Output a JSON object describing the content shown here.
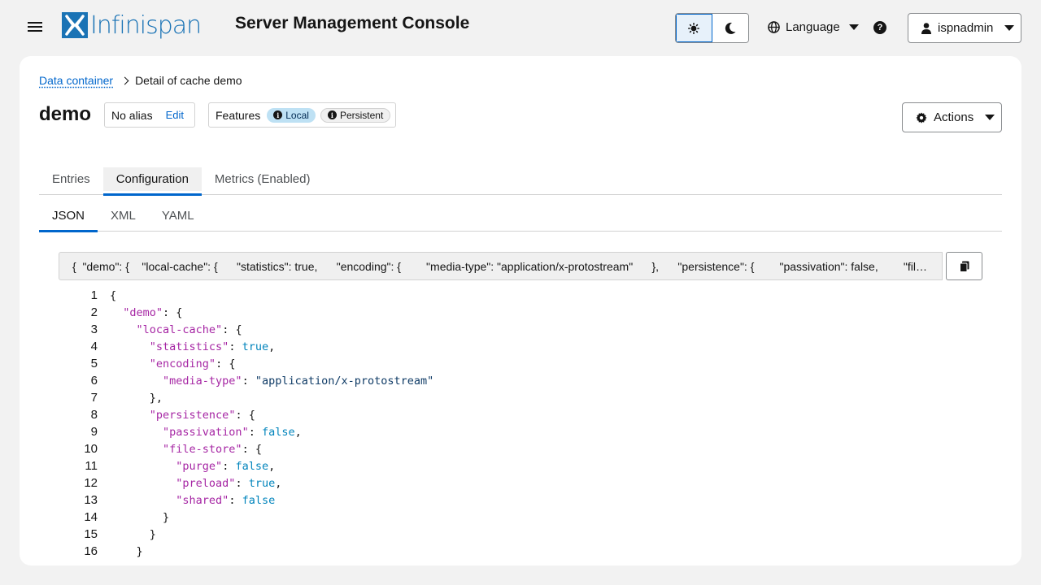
{
  "header": {
    "brand": "Infinispan",
    "title": "Server Management Console",
    "language_label": "Language",
    "help_glyph": "?",
    "user_label": "ispnadmin"
  },
  "breadcrumb": {
    "parent": "Data container",
    "current": "Detail of cache demo"
  },
  "cache": {
    "name": "demo",
    "alias": "No alias",
    "edit_label": "Edit",
    "features_label": "Features",
    "features": [
      "Local",
      "Persistent"
    ]
  },
  "actions_label": "Actions",
  "tabs": [
    {
      "label": "Entries"
    },
    {
      "label": "Configuration",
      "active": true
    },
    {
      "label": "Metrics (Enabled)"
    }
  ],
  "subtabs": [
    {
      "label": "JSON",
      "active": true
    },
    {
      "label": "XML"
    },
    {
      "label": "YAML"
    }
  ],
  "preview_text": "{  \"demo\": {    \"local-cache\": {      \"statistics\": true,      \"encoding\": {        \"media-type\": \"application/x-protostream\"      },      \"persistence\": {        \"passivation\": false,        \"file-store\": {",
  "code_lines": [
    {
      "n": "1",
      "text": "{"
    },
    {
      "n": "2",
      "text": "  \"demo\": {"
    },
    {
      "n": "3",
      "text": "    \"local-cache\": {"
    },
    {
      "n": "4",
      "text": "      \"statistics\": true,"
    },
    {
      "n": "5",
      "text": "      \"encoding\": {"
    },
    {
      "n": "6",
      "text": "        \"media-type\": \"application/x-protostream\""
    },
    {
      "n": "7",
      "text": "      },"
    },
    {
      "n": "8",
      "text": "      \"persistence\": {"
    },
    {
      "n": "9",
      "text": "        \"passivation\": false,"
    },
    {
      "n": "10",
      "text": "        \"file-store\": {"
    },
    {
      "n": "11",
      "text": "          \"purge\": false,"
    },
    {
      "n": "12",
      "text": "          \"preload\": true,"
    },
    {
      "n": "13",
      "text": "          \"shared\": false"
    },
    {
      "n": "14",
      "text": "        }"
    },
    {
      "n": "15",
      "text": "      }"
    },
    {
      "n": "16",
      "text": "    }"
    }
  ],
  "colors": {
    "brand": "#1a73b5",
    "link": "#0066cc",
    "key": "#a626a4",
    "bool": "#0184bc"
  }
}
